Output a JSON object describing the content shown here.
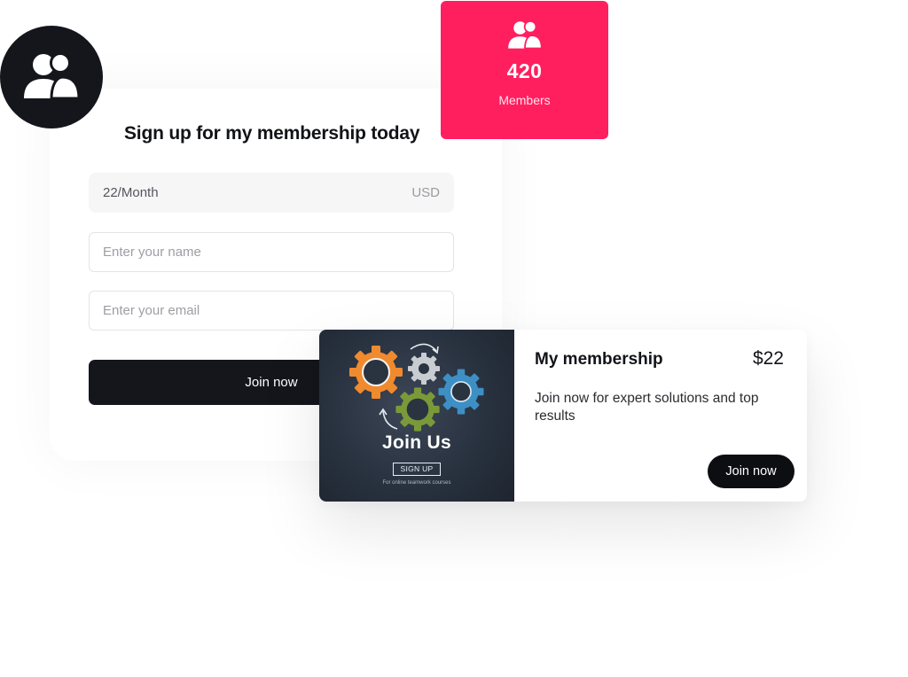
{
  "signup": {
    "title": "Sign up for my membership today",
    "price": {
      "value": "22/Month",
      "currency": "USD"
    },
    "name_placeholder": "Enter your name",
    "email_placeholder": "Enter your email",
    "join_label": "Join now"
  },
  "members": {
    "count": "420",
    "label": "Members",
    "icon": "users-icon",
    "color": "#ff1f5f"
  },
  "avatar": {
    "icon": "users-icon",
    "color": "#15161c"
  },
  "membership": {
    "banner": {
      "title": "Join Us",
      "button_label": "SIGN UP",
      "caption": "For online teamwork courses",
      "gear_colors": [
        "#f08a2e",
        "#c9ccd1",
        "#3d8fc4",
        "#7a9a3a"
      ]
    },
    "title": "My membership",
    "price": "$22",
    "description": "Join now for expert solutions and top results",
    "join_label": "Join now"
  }
}
